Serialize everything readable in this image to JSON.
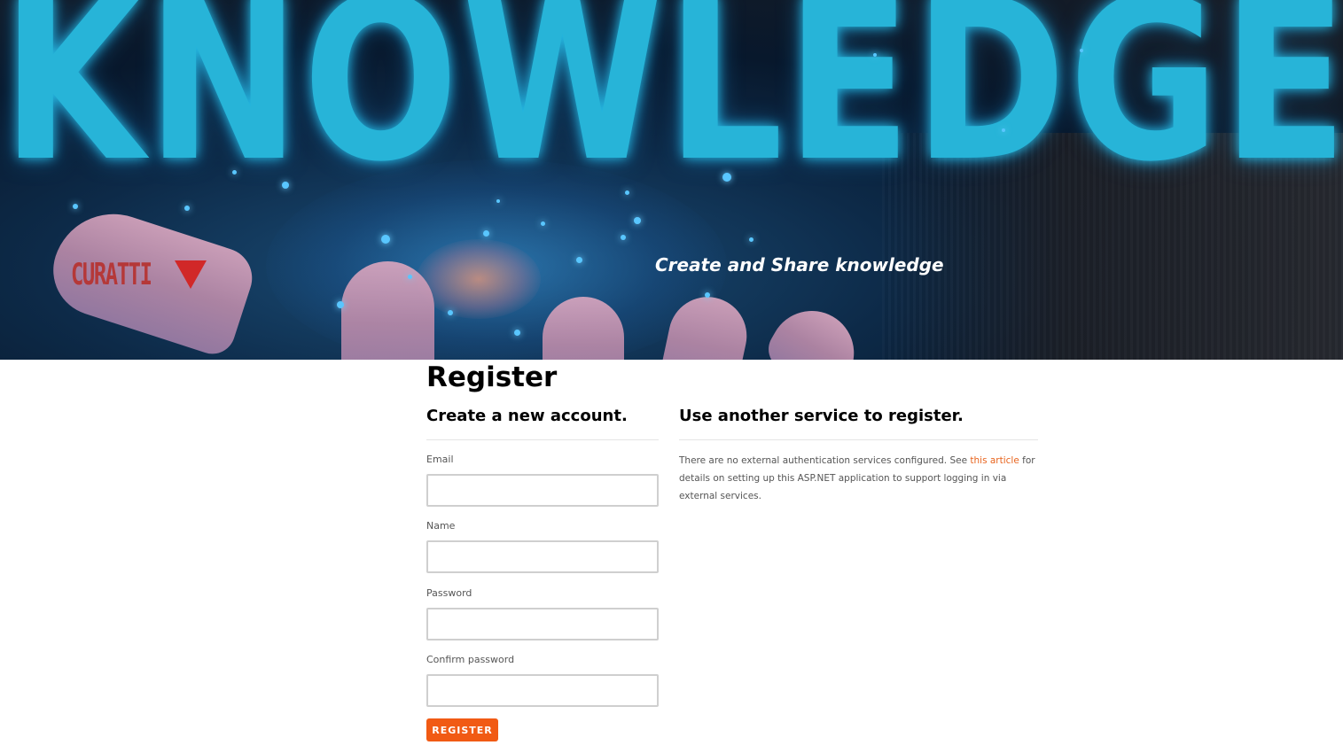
{
  "hero": {
    "banner_word": "KNOWLEDGE",
    "logo_text": "CURATTI",
    "tagline": "Create and Share knowledge"
  },
  "page": {
    "title": "Register"
  },
  "local_account": {
    "heading": "Create a new account.",
    "fields": [
      {
        "label": "Email",
        "value": ""
      },
      {
        "label": "Name",
        "value": ""
      },
      {
        "label": "Password",
        "value": ""
      },
      {
        "label": "Confirm password",
        "value": ""
      }
    ],
    "submit_label": "REGISTER"
  },
  "external_services": {
    "heading": "Use another service to register.",
    "text_before_link": "There are no external authentication services configured. See ",
    "link_text": "this article",
    "text_after_link": " for details on setting up this ASP.NET application to support logging in via external services."
  },
  "colors": {
    "accent": "#f15a14",
    "link": "#e8641e",
    "hero_text": "#27b4d8",
    "logo": "#b53838"
  }
}
